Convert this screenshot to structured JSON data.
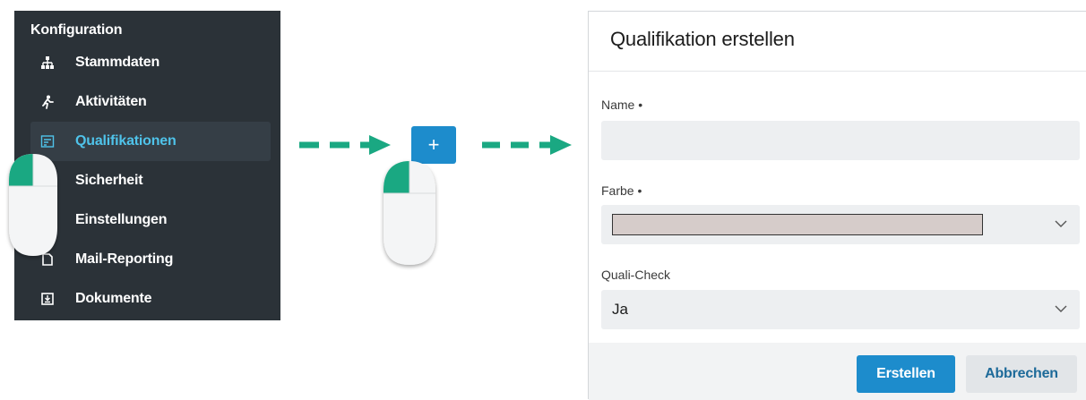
{
  "sidebar": {
    "title": "Konfiguration",
    "items": [
      {
        "label": "Stammdaten",
        "icon": "sitemap-icon"
      },
      {
        "label": "Aktivitäten",
        "icon": "activity-icon"
      },
      {
        "label": "Qualifikationen",
        "icon": "qualification-icon",
        "active": true
      },
      {
        "label": "Sicherheit",
        "icon": "lock-icon"
      },
      {
        "label": "Einstellungen",
        "icon": "settings-icon"
      },
      {
        "label": "Mail-Reporting",
        "icon": "mail-report-icon"
      },
      {
        "label": "Dokumente",
        "icon": "document-icon"
      }
    ]
  },
  "add_button": {
    "label": "+"
  },
  "dialog": {
    "title": "Qualifikation erstellen",
    "name_label": "Name •",
    "name_value": "",
    "color_label": "Farbe •",
    "color_value": "#d6ccca",
    "quali_check_label": "Quali-Check",
    "quali_check_value": "Ja",
    "submit_label": "Erstellen",
    "cancel_label": "Abbrechen"
  },
  "colors": {
    "sidebar_bg": "#2b3238",
    "active_text": "#4fc3ea",
    "primary": "#1d8ccc",
    "arrow": "#1aa882"
  }
}
